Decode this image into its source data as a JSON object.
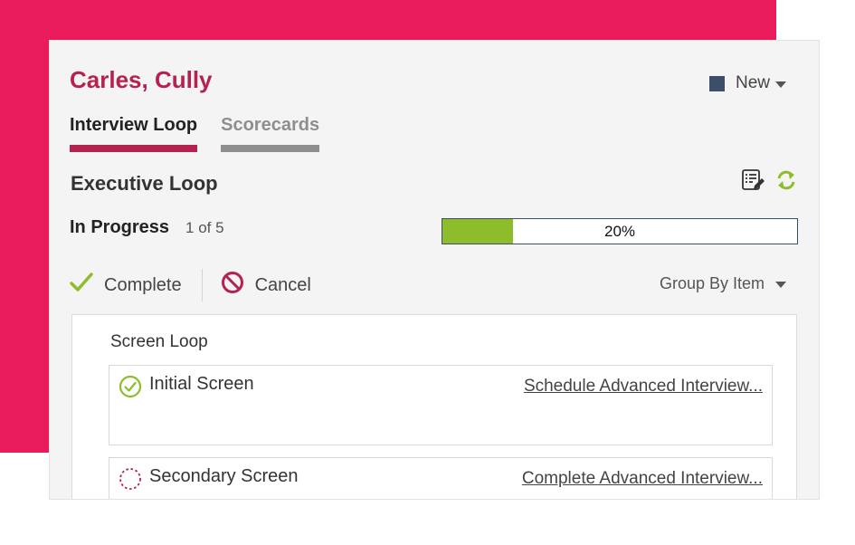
{
  "candidate": {
    "name": "Carles, Cully"
  },
  "status_select": {
    "value": "New",
    "color": "#3c4e68"
  },
  "tabs": [
    {
      "label": "Interview Loop",
      "active": true
    },
    {
      "label": "Scorecards",
      "active": false
    }
  ],
  "loop": {
    "title": "Executive Loop"
  },
  "toolbar": {
    "icons": [
      "notes-edit-icon",
      "refresh-icon"
    ]
  },
  "progress": {
    "status": "In Progress",
    "count": "1 of 5",
    "percent": 20,
    "percent_label": "20%",
    "fill_color": "#8dbd2b"
  },
  "actions": {
    "complete_label": "Complete",
    "cancel_label": "Cancel"
  },
  "group_by": {
    "label": "Group By Item"
  },
  "section": {
    "title": "Screen Loop",
    "items": [
      {
        "name": "Initial Screen",
        "status": "completed",
        "icon": "check-circle-icon",
        "link": "Schedule Advanced Interview..."
      },
      {
        "name": "Secondary Screen",
        "status": "pending",
        "icon": "dashed-circle-icon",
        "link": "Complete Advanced Interview..."
      }
    ]
  },
  "colors": {
    "background_accent": "#e91b5b",
    "brand": "#b52250",
    "success": "#8dbd2b"
  }
}
